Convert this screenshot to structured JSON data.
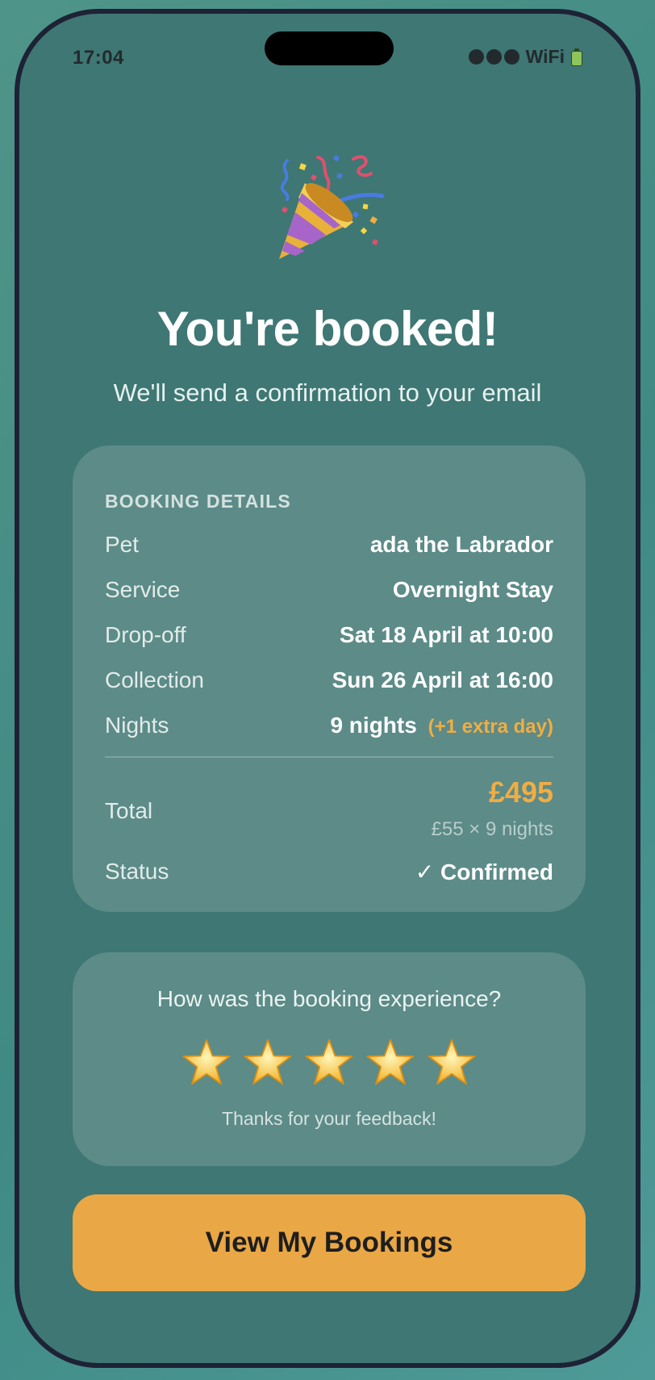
{
  "status_bar": {
    "time": "17:04",
    "wifi_label": "WiFi",
    "icons": [
      "signal-dots-icon",
      "battery-icon"
    ]
  },
  "header": {
    "emoji_icon": "party-popper-icon",
    "title": "You're booked!",
    "subtitle": "We'll send a confirmation to your email"
  },
  "details": {
    "heading": "BOOKING DETAILS",
    "rows": [
      {
        "label": "Pet",
        "value": "ada the Labrador"
      },
      {
        "label": "Service",
        "value": "Overnight Stay"
      },
      {
        "label": "Drop-off",
        "value": "Sat 18 April at 10:00"
      },
      {
        "label": "Collection",
        "value": "Sun 26 April at 16:00"
      },
      {
        "label": "Nights",
        "value": "9 nights",
        "extra": "(+1 extra day)"
      }
    ],
    "total_label": "Total",
    "total_amount": "£495",
    "total_breakdown": "£55 × 9 nights",
    "status_label": "Status",
    "status_value": "✓ Confirmed"
  },
  "feedback": {
    "question": "How was the booking experience?",
    "rating": 5,
    "max_rating": 5,
    "thanks": "Thanks for your feedback!"
  },
  "cta": {
    "label": "View My Bookings"
  },
  "colors": {
    "screen_bg": "#3e7774",
    "card_bg": "#5c8b88",
    "accent": "#e9a745",
    "price": "#f0ad44",
    "confirmed": "#90e29f",
    "frame": "#1e2235"
  }
}
